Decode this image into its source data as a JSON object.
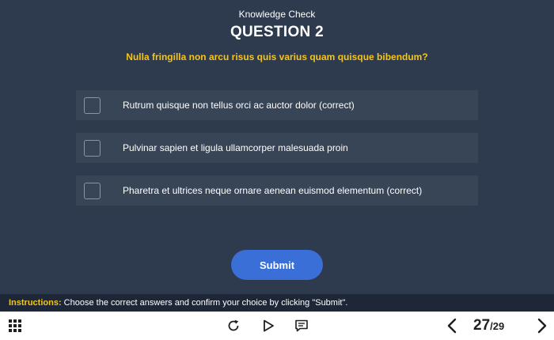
{
  "header": {
    "kicker": "Knowledge Check",
    "title": "QUESTION 2",
    "question": "Nulla fringilla non arcu risus quis varius quam quisque bibendum?"
  },
  "options": [
    {
      "label": "Rutrum quisque non tellus orci ac auctor dolor (correct)",
      "checked": false
    },
    {
      "label": "Pulvinar sapien et ligula ullamcorper malesuada proin",
      "checked": false
    },
    {
      "label": "Pharetra et ultrices neque ornare aenean euismod elementum (correct)",
      "checked": false
    }
  ],
  "submit_label": "Submit",
  "instructions": {
    "key": "Instructions:",
    "text": " Choose the correct answers and confirm your choice by clicking \"Submit\"."
  },
  "footer": {
    "current_slide": "27",
    "separator": "/",
    "total_slides": "29",
    "icons": [
      "grid-menu-icon",
      "replay-icon",
      "play-icon",
      "captions-icon",
      "prev-icon",
      "next-icon"
    ]
  },
  "colors": {
    "stage_bg": "#2e3a4d",
    "option_bg": "#384557",
    "accent_yellow": "#f5c518",
    "submit_blue": "#3a6fd8",
    "instr_bg": "#1d2737"
  }
}
